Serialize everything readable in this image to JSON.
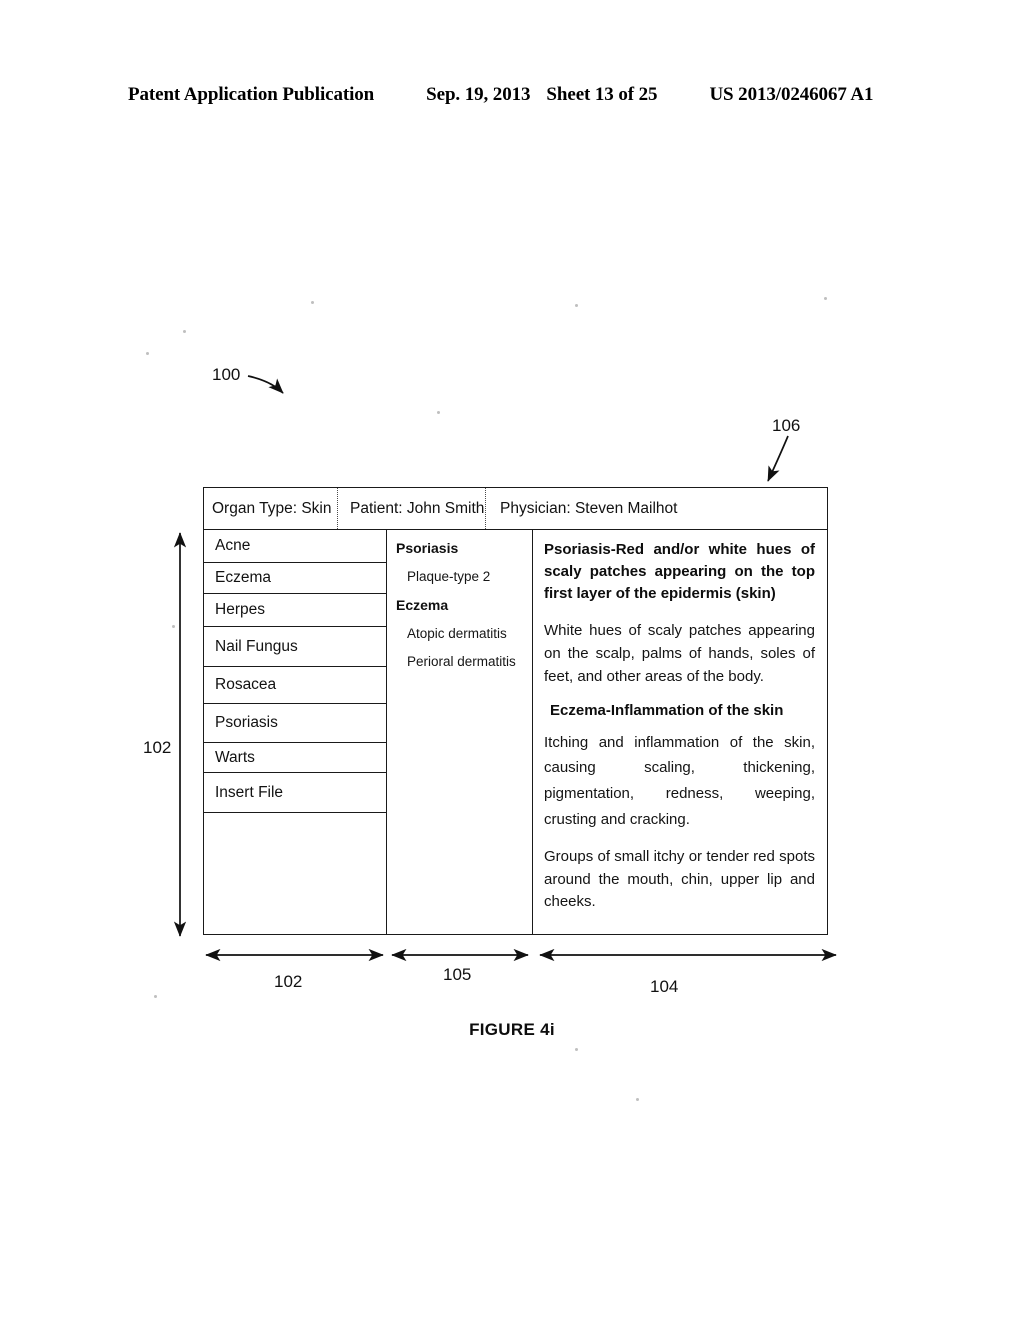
{
  "page_header": {
    "publication": "Patent Application Publication",
    "date": "Sep. 19, 2013",
    "sheet": "Sheet 13 of 25",
    "patent_number": "US 2013/0246067 A1"
  },
  "figure": {
    "caption": "FIGURE 4i",
    "callouts": {
      "system": "100",
      "header_bar": "106",
      "left_column_vertical": "102",
      "dim_left": "102",
      "dim_middle": "105",
      "dim_right": "104"
    }
  },
  "table": {
    "header": {
      "organ_type": "Organ Type: Skin",
      "patient": "Patient: John Smith",
      "physician": "Physician: Steven Mailhot"
    },
    "condition_list": [
      {
        "label": "Acne"
      },
      {
        "label": "Eczema"
      },
      {
        "label": "Herpes"
      },
      {
        "label": "Nail Fungus"
      },
      {
        "label": "Rosacea"
      },
      {
        "label": "Psoriasis"
      },
      {
        "label": "Warts"
      },
      {
        "label": "Insert File"
      }
    ],
    "subtypes": [
      {
        "group": "Psoriasis",
        "items": [
          "Plaque-type 2"
        ]
      },
      {
        "group": "Eczema",
        "items": [
          "Atopic dermatitis",
          "Perioral dermatitis"
        ]
      }
    ],
    "description": {
      "psoriasis_heading": "Psoriasis-Red and/or white hues of scaly patches appearing on the top first layer of the epidermis (skin)",
      "psoriasis_body": "White hues of scaly patches appearing on the scalp, palms of hands,  soles of feet, and other areas of the body.",
      "eczema_heading": "Eczema-Inflammation of the skin",
      "eczema_body": "Itching and inflammation of the skin, causing scaling, thickening, pigmentation, redness, weeping, crusting and cracking.",
      "perioral_body": "Groups of small itchy or tender red spots around the mouth, chin, upper lip and cheeks."
    }
  }
}
